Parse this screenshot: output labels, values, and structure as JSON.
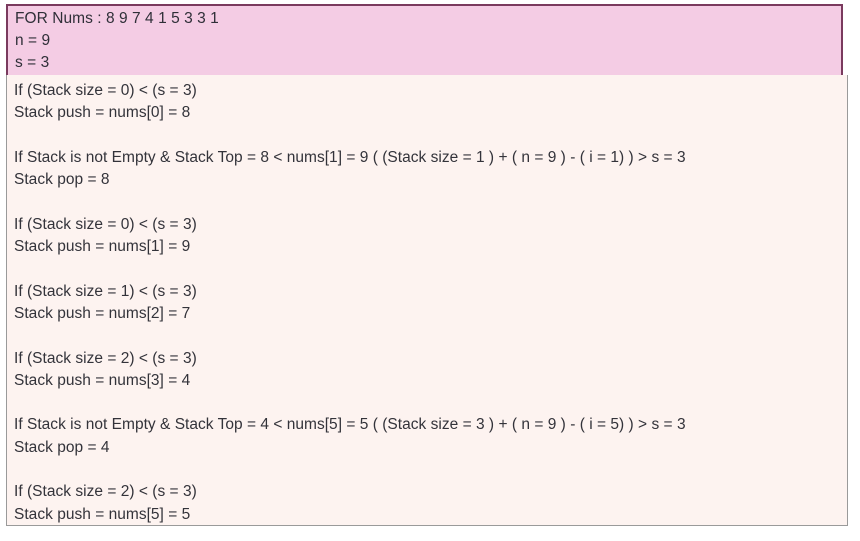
{
  "header": {
    "lines": [
      "FOR Nums : 8 9 7 4 1 5 3 3 1",
      "n = 9",
      "s = 3"
    ],
    "background_color": "#f4cce4",
    "border_color": "#7a3a5e",
    "text_color": "#2f2f38"
  },
  "body": {
    "background_color": "#fdf3f0",
    "border_color": "#9a9a9a",
    "text_color": "#33333a",
    "lines": [
      "If (Stack size = 0) < (s = 3)",
      "Stack push = nums[0] = 8",
      "",
      "If Stack is not Empty & Stack Top = 8 < nums[1] = 9 ( (Stack size = 1 ) + ( n = 9 ) - ( i = 1) ) > s = 3",
      "Stack pop = 8",
      "",
      "If (Stack size = 0) < (s = 3)",
      "Stack push = nums[1] = 9",
      "",
      "If (Stack size = 1) < (s = 3)",
      "Stack push = nums[2] = 7",
      "",
      "If (Stack size = 2) < (s = 3)",
      "Stack push = nums[3] = 4",
      "",
      "If Stack is not Empty & Stack Top = 4 < nums[5] = 5 ( (Stack size = 3 ) + ( n = 9 ) - ( i = 5) ) > s = 3",
      "Stack pop = 4",
      "",
      "If (Stack size = 2) < (s = 3)",
      "Stack push = nums[5] = 5"
    ]
  }
}
